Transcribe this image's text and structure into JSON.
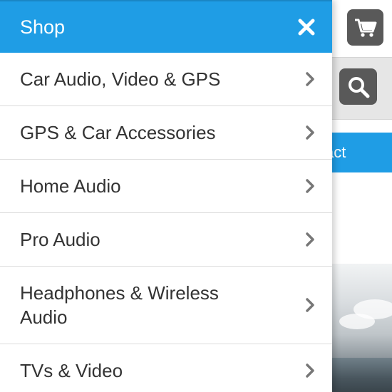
{
  "drawer": {
    "title": "Shop",
    "items": [
      {
        "label": "Car Audio, Video & GPS"
      },
      {
        "label": "GPS & Car Accessories"
      },
      {
        "label": "Home Audio"
      },
      {
        "label": "Pro Audio"
      },
      {
        "label": "Headphones & Wireless Audio"
      },
      {
        "label": "TVs & Video"
      }
    ]
  },
  "background": {
    "contact_label": "act"
  },
  "icons": {
    "close": "close-icon",
    "chevron": "chevron-right-icon",
    "cart": "cart-icon",
    "search": "search-icon"
  },
  "colors": {
    "accent": "#1f9de5",
    "icon_button": "#595959"
  }
}
